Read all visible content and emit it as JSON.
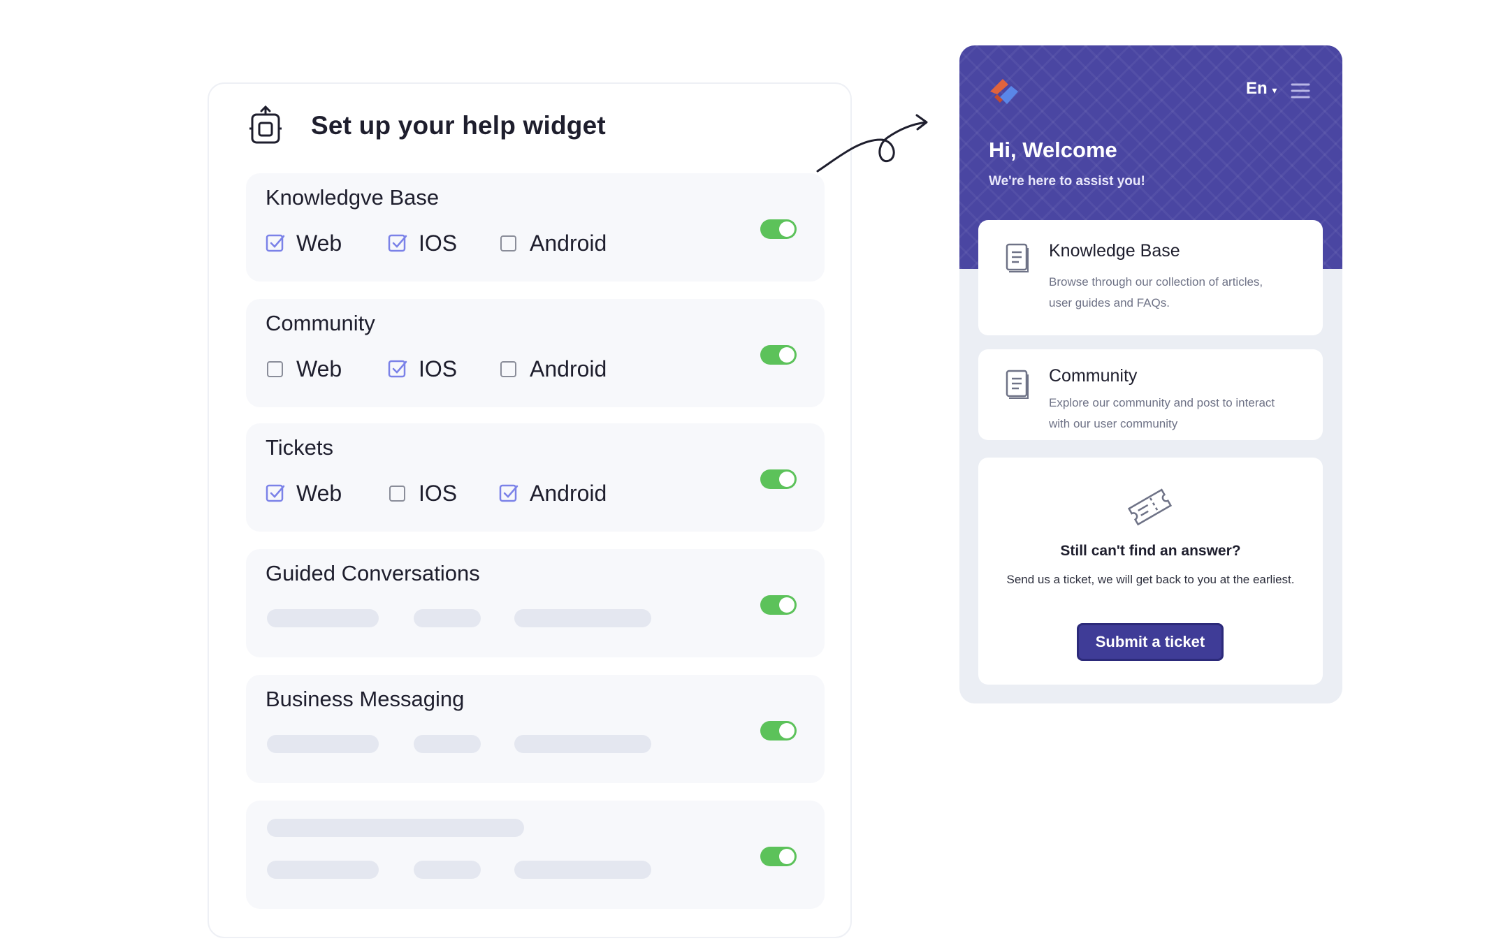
{
  "setup": {
    "title": "Set up your help widget",
    "icon": "setup-widget-icon",
    "sections": [
      {
        "name": "Knowledgve Base",
        "enabled": true,
        "options": [
          {
            "label": "Web",
            "checked": true
          },
          {
            "label": "IOS",
            "checked": true
          },
          {
            "label": "Android",
            "checked": false
          }
        ]
      },
      {
        "name": "Community",
        "enabled": true,
        "options": [
          {
            "label": "Web",
            "checked": false
          },
          {
            "label": "IOS",
            "checked": true
          },
          {
            "label": "Android",
            "checked": false
          }
        ]
      },
      {
        "name": "Tickets",
        "enabled": true,
        "options": [
          {
            "label": "Web",
            "checked": true
          },
          {
            "label": "IOS",
            "checked": false
          },
          {
            "label": "Android",
            "checked": true
          }
        ]
      },
      {
        "name": "Guided Conversations",
        "enabled": true
      },
      {
        "name": "Business Messaging",
        "enabled": true
      },
      {
        "name": "",
        "enabled": true
      }
    ]
  },
  "widget": {
    "language": "En",
    "greeting": "Hi, Welcome",
    "subgreeting": "We're here to assist you!",
    "cards": [
      {
        "title": "Knowledge Base",
        "description": "Browse through our collection of articles, user guides and FAQs.",
        "icon": "book-icon"
      },
      {
        "title": "Community",
        "description": "Explore our community and post to interact with our user community",
        "icon": "book-icon"
      }
    ],
    "ticket": {
      "title": "Still can't find an answer?",
      "description": "Send us a ticket, we will get back to you at the earliest.",
      "button": "Submit a ticket",
      "icon": "ticket-icon"
    }
  },
  "colors": {
    "brand": "#4a46a2",
    "button": "#3f3c97",
    "toggle_on": "#5cc25a",
    "checkbox": "#7b82e8",
    "logo_orange": "#e0633d"
  }
}
